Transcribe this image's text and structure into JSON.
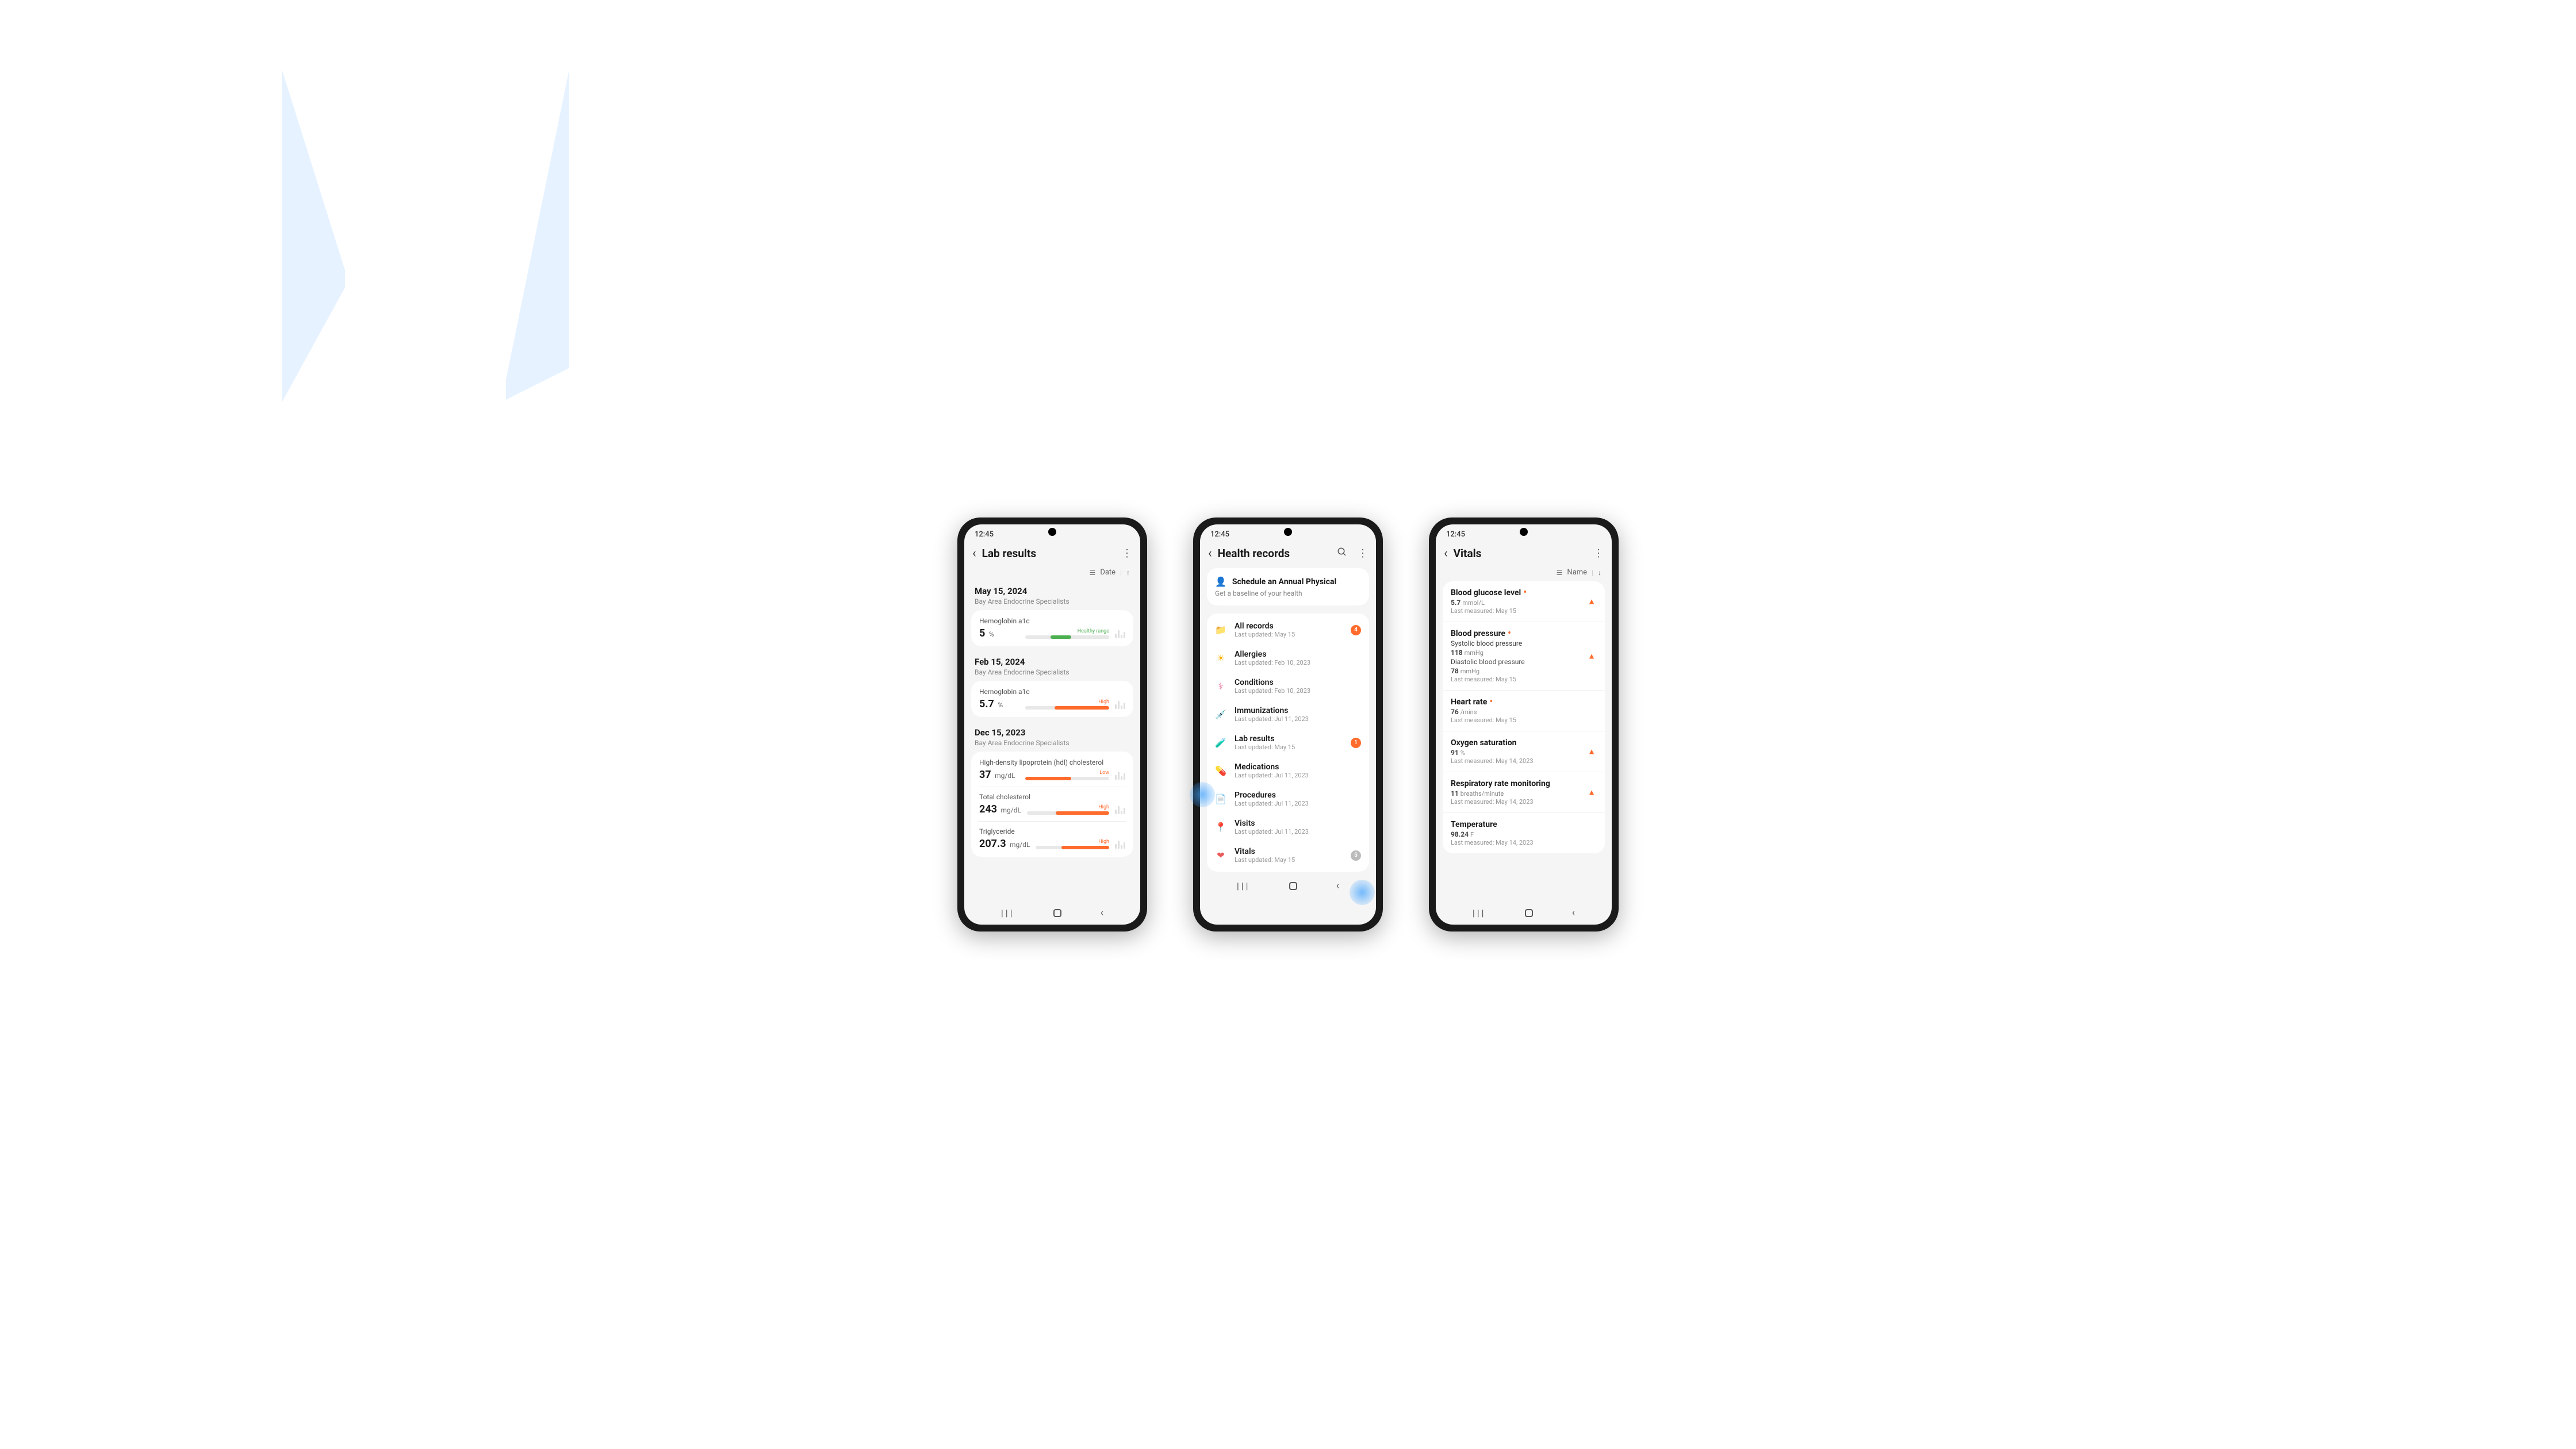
{
  "status_time": "12:45",
  "phone1": {
    "title": "Lab results",
    "sort": "Date",
    "sections": [
      {
        "date": "May 15, 2024",
        "provider": "Bay Area Endocrine Specialists",
        "items": [
          {
            "name": "Hemoglobin a1c",
            "value": "5",
            "unit": "%",
            "range": "Healthy range",
            "status": "healthy"
          }
        ]
      },
      {
        "date": "Feb 15, 2024",
        "provider": "Bay Area Endocrine Specialists",
        "items": [
          {
            "name": "Hemoglobin a1c",
            "value": "5.7",
            "unit": "%",
            "range": "High",
            "status": "high"
          }
        ]
      },
      {
        "date": "Dec 15, 2023",
        "provider": "Bay Area Endocrine Specialists",
        "items": [
          {
            "name": "High-density lipoprotein (hdl) cholesterol",
            "value": "37",
            "unit": "mg/dL",
            "range": "Low",
            "status": "low"
          },
          {
            "name": "Total cholesterol",
            "value": "243",
            "unit": "mg/dL",
            "range": "High",
            "status": "high"
          },
          {
            "name": "Triglyceride",
            "value": "207.3",
            "unit": "mg/dL",
            "range": "High",
            "status": "high"
          }
        ]
      }
    ]
  },
  "phone2": {
    "title": "Health records",
    "banner_title": "Schedule an Annual Physical",
    "banner_sub": "Get a baseline of your health",
    "items": [
      {
        "icon": "📁",
        "color": "#2aa876",
        "title": "All records",
        "sub": "Last updated: May 15",
        "badge": "4"
      },
      {
        "icon": "☀",
        "color": "#ffb300",
        "title": "Allergies",
        "sub": "Last updated: Feb 10, 2023",
        "badge": ""
      },
      {
        "icon": "⚕",
        "color": "#e85a8c",
        "title": "Conditions",
        "sub": "Last updated: Feb 10, 2023",
        "badge": ""
      },
      {
        "icon": "💉",
        "color": "#5a9ae8",
        "title": "Immunizations",
        "sub": "Last updated: Jul 11, 2023",
        "badge": ""
      },
      {
        "icon": "🧪",
        "color": "#4890e0",
        "title": "Lab results",
        "sub": "Last updated: May 15",
        "badge": "1"
      },
      {
        "icon": "💊",
        "color": "#8a6ae8",
        "title": "Medications",
        "sub": "Last updated: Jul 11, 2023",
        "badge": ""
      },
      {
        "icon": "📄",
        "color": "#2aa88e",
        "title": "Procedures",
        "sub": "Last updated: Jul 11, 2023",
        "badge": ""
      },
      {
        "icon": "📍",
        "color": "#4890e0",
        "title": "Visits",
        "sub": "Last updated: Jul 11, 2023",
        "badge": ""
      },
      {
        "icon": "❤",
        "color": "#e85a5a",
        "title": "Vitals",
        "sub": "Last updated: May 15",
        "badge": "5",
        "badge_grey": true
      }
    ]
  },
  "phone3": {
    "title": "Vitals",
    "sort": "Name",
    "items": [
      {
        "title": "Blood glucose level",
        "flag": true,
        "warn": true,
        "readings": [
          {
            "v": "5.7",
            "u": "mmol/L"
          }
        ],
        "meta": "Last measured: May 15"
      },
      {
        "title": "Blood pressure",
        "flag": true,
        "warn": true,
        "readings": [
          {
            "label": "Systolic blood pressure",
            "v": "118",
            "u": "mmHg"
          },
          {
            "label": "Diastolic blood pressure",
            "v": "78",
            "u": "mmHg"
          }
        ],
        "meta": "Last measured: May 15"
      },
      {
        "title": "Heart rate",
        "flag": true,
        "warn": false,
        "readings": [
          {
            "v": "76",
            "u": "/mins"
          }
        ],
        "meta": "Last measured: May 15"
      },
      {
        "title": "Oxygen saturation",
        "flag": false,
        "warn": true,
        "readings": [
          {
            "v": "91",
            "u": "%"
          }
        ],
        "meta": "Last measured: May 14, 2023"
      },
      {
        "title": "Respiratory rate monitoring",
        "flag": false,
        "warn": true,
        "readings": [
          {
            "v": "11",
            "u": "breaths/minute"
          }
        ],
        "meta": "Last measured: May 14, 2023"
      },
      {
        "title": "Temperature",
        "flag": false,
        "warn": false,
        "readings": [
          {
            "v": "98.24",
            "u": "F"
          }
        ],
        "meta": "Last measured: May 14, 2023"
      }
    ]
  }
}
